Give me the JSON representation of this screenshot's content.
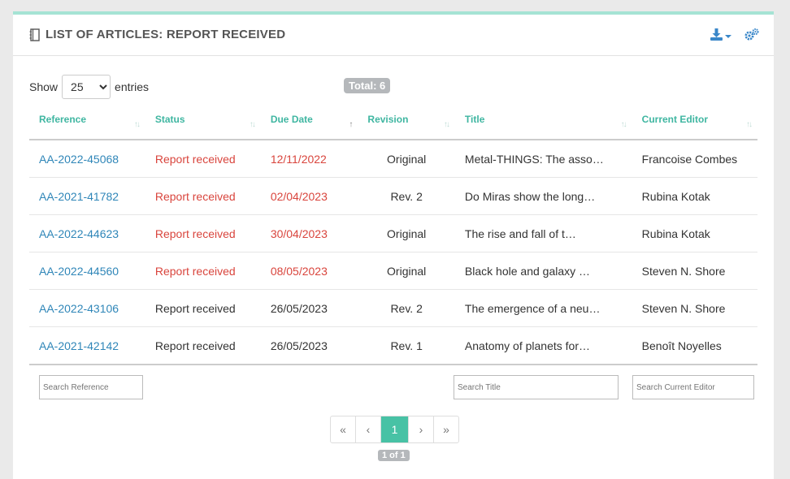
{
  "header": {
    "title": "LIST OF ARTICLES: REPORT RECEIVED",
    "title_icon": "book-icon",
    "download_icon": "download-icon",
    "settings_icon": "gears-icon"
  },
  "controls": {
    "show_label": "Show",
    "entries_selected": "25",
    "entries_label": "entries",
    "total": "Total: 6"
  },
  "table": {
    "columns": [
      "Reference",
      "Status",
      "Due Date",
      "Revision",
      "Title",
      "Current Editor"
    ],
    "rows": [
      {
        "reference": "AA-2022-45068",
        "status": "Report received",
        "due": "12/11/2022",
        "revision": "Original",
        "title": "Metal-THINGS: The asso…",
        "editor": "Francoise Combes"
      },
      {
        "reference": "AA-2021-41782",
        "status": "Report received",
        "due": "02/04/2023",
        "revision": "Rev. 2",
        "title": "Do Miras show the long…",
        "editor": "Rubina Kotak"
      },
      {
        "reference": "AA-2022-44623",
        "status": "Report received",
        "due": "30/04/2023",
        "revision": "Original",
        "title": "The rise and fall of t…",
        "editor": "Rubina Kotak"
      },
      {
        "reference": "AA-2022-44560",
        "status": "Report received",
        "due": "08/05/2023",
        "revision": "Original",
        "title": "Black hole and galaxy …",
        "editor": "Steven N. Shore"
      },
      {
        "reference": "AA-2022-43106",
        "status": "Report received",
        "due": "26/05/2023",
        "revision": "Rev. 2",
        "title": "The emergence of a neu…",
        "editor": "Steven N. Shore"
      },
      {
        "reference": "AA-2021-42142",
        "status": "Report received",
        "due": "26/05/2023",
        "revision": "Rev. 1",
        "title": "Anatomy of planets for…",
        "editor": "Benoît Noyelles"
      }
    ]
  },
  "search": {
    "reference_placeholder": "Search Reference",
    "title_placeholder": "Search Title",
    "editor_placeholder": "Search Current Editor"
  },
  "pagination": {
    "first": "«",
    "prev": "‹",
    "current": "1",
    "next": "›",
    "last": "»",
    "info": "1 of 1"
  },
  "colors": {
    "accent": "#48c2a5",
    "link": "#2f86b8",
    "overdue": "#d9453d"
  }
}
